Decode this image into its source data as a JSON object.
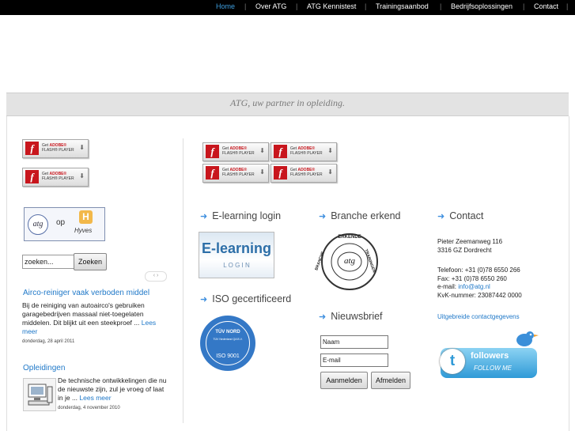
{
  "nav": {
    "items": [
      {
        "label": "Home",
        "active": true
      },
      {
        "label": "Over ATG"
      },
      {
        "label": "ATG Kennistest"
      },
      {
        "label": "Trainingsaanbod"
      },
      {
        "label": "Bedrijfsoplossingen"
      },
      {
        "label": "Contact"
      }
    ],
    "separator": "|"
  },
  "tagline": "ATG, uw partner in opleiding.",
  "flash_badge": {
    "line1_prefix": "Get ",
    "line1_brand": "ADOBE®",
    "line2": "FLASH® PLAYER",
    "letter": "f"
  },
  "hyves": {
    "left": "atg",
    "mid": "op",
    "right": "Hyves"
  },
  "search": {
    "placeholder": "zoeken...",
    "button": "Zoeken",
    "pager": "‹ ›"
  },
  "news": [
    {
      "title": "Airco-reiniger vaak verboden middel",
      "body": "Bij de reiniging van autoairco's gebruiken garagebedrijven massaal niet-toegelaten middelen. Dit blijkt uit een steekproef ...",
      "more": "Lees meer",
      "date": "donderdag, 28 april 2011"
    },
    {
      "title": "Opleidingen",
      "body": "De technische ontwikkelingen die nu de nieuwste zijn, zul je vroeg of laat in je ...",
      "more": "Lees meer",
      "date": "donderdag, 4 november 2010"
    }
  ],
  "sections": {
    "elearning": "E-learning login",
    "iso": "ISO gecertificeerd",
    "branche": "Branche erkend",
    "nieuwsbrief": "Nieuwsbrief",
    "contact": "Contact"
  },
  "elearning_logo": {
    "main": "E-learning",
    "sub": "L O G I N"
  },
  "iso_logo": {
    "top": "TÜV NORD",
    "mid": "TÜV Nederland QA B.V.",
    "bottom": "ISO 9001"
  },
  "branche_logo": {
    "ring_top": "ERKENDE",
    "ring_left": "BRANCHE",
    "ring_right": "TRAININGEN",
    "center": "atg"
  },
  "newsletter": {
    "name_placeholder": "Naam",
    "email_placeholder": "E-mail",
    "subscribe": "Aanmelden",
    "unsubscribe": "Afmelden"
  },
  "contact": {
    "street": "Pieter Zeemanweg 116",
    "city": "3316 GZ Dordrecht",
    "phone": "Telefoon: +31 (0)78 6550 266",
    "fax": "Fax: +31 (0)78 6550 260",
    "email_label": "e-mail: ",
    "email": "info@atg.nl",
    "kvk": "KvK-nummer: 23087442 0000",
    "link": "Uitgebreide contactgegevens"
  },
  "twitter": {
    "followers": "followers",
    "follow": "FOLLOW ME"
  },
  "colors": {
    "nav_bg": "#000000",
    "nav_active": "#3f9fdf",
    "link": "#1f78c8",
    "band": "#e3e3e3",
    "flash_red": "#c8161d"
  }
}
